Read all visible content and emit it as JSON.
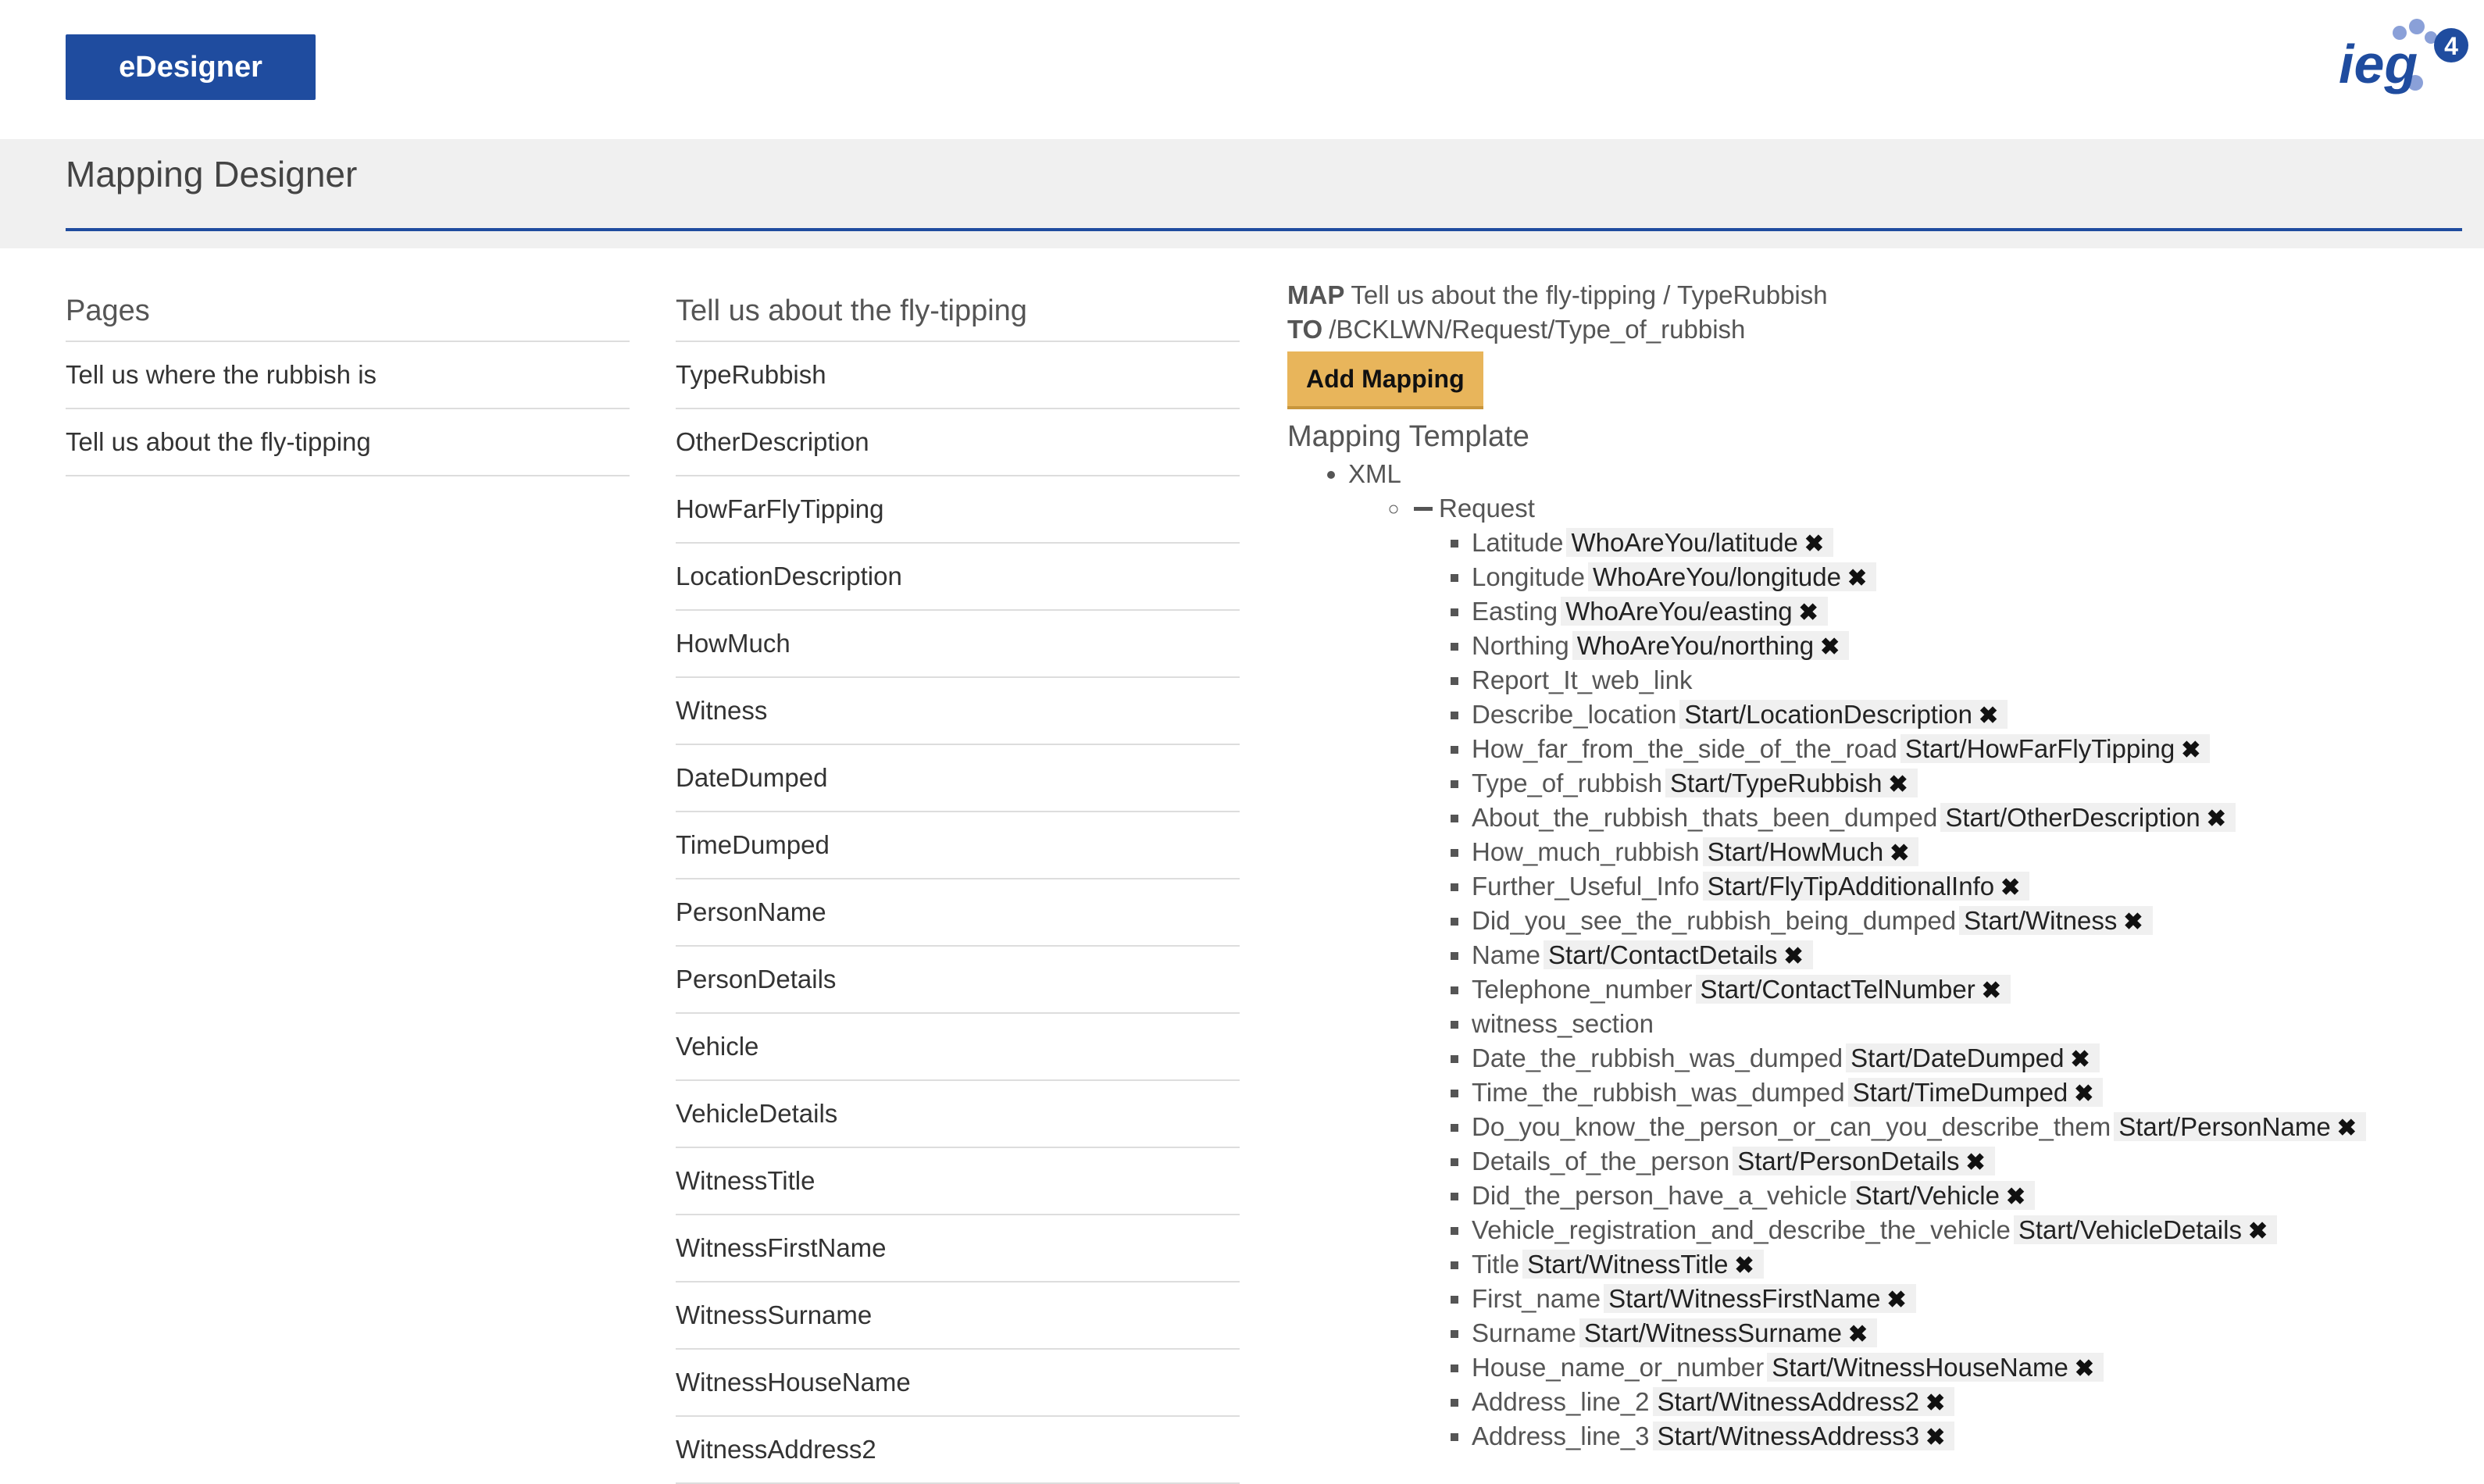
{
  "header": {
    "brand_label": "eDesigner",
    "logo_text": "ieg",
    "logo_badge": "4",
    "logo_colors": {
      "text": "#1f4c9f",
      "dots": "#8aa0d8",
      "badge": "#1f4c9f"
    }
  },
  "page_title": "Mapping Designer",
  "pages": {
    "heading": "Pages",
    "items": [
      {
        "label": "Tell us where the rubbish is"
      },
      {
        "label": "Tell us about the fly-tipping"
      }
    ]
  },
  "fields": {
    "heading": "Tell us about the fly-tipping",
    "items": [
      {
        "label": "TypeRubbish"
      },
      {
        "label": "OtherDescription"
      },
      {
        "label": "HowFarFlyTipping"
      },
      {
        "label": "LocationDescription"
      },
      {
        "label": "HowMuch"
      },
      {
        "label": "Witness"
      },
      {
        "label": "DateDumped"
      },
      {
        "label": "TimeDumped"
      },
      {
        "label": "PersonName"
      },
      {
        "label": "PersonDetails"
      },
      {
        "label": "Vehicle"
      },
      {
        "label": "VehicleDetails"
      },
      {
        "label": "WitnessTitle"
      },
      {
        "label": "WitnessFirstName"
      },
      {
        "label": "WitnessSurname"
      },
      {
        "label": "WitnessHouseName"
      },
      {
        "label": "WitnessAddress2"
      }
    ]
  },
  "mapping": {
    "map_keyword": "MAP",
    "map_value": "Tell us about the fly-tipping / TypeRubbish",
    "to_keyword": "TO",
    "to_value": "/BCKLWN/Request/Type_of_rubbish",
    "add_button_label": "Add Mapping",
    "template_heading": "Mapping Template",
    "root": "XML",
    "request": "Request",
    "remove_icon": "✖",
    "entries": [
      {
        "name": "Latitude",
        "target": "WhoAreYou/latitude"
      },
      {
        "name": "Longitude",
        "target": "WhoAreYou/longitude"
      },
      {
        "name": "Easting",
        "target": "WhoAreYou/easting"
      },
      {
        "name": "Northing",
        "target": "WhoAreYou/northing"
      },
      {
        "name": "Report_It_web_link",
        "target": null
      },
      {
        "name": "Describe_location",
        "target": "Start/LocationDescription"
      },
      {
        "name": "How_far_from_the_side_of_the_road",
        "target": "Start/HowFarFlyTipping"
      },
      {
        "name": "Type_of_rubbish",
        "target": "Start/TypeRubbish"
      },
      {
        "name": "About_the_rubbish_thats_been_dumped",
        "target": "Start/OtherDescription"
      },
      {
        "name": "How_much_rubbish",
        "target": "Start/HowMuch"
      },
      {
        "name": "Further_Useful_Info",
        "target": "Start/FlyTipAdditionalInfo"
      },
      {
        "name": "Did_you_see_the_rubbish_being_dumped",
        "target": "Start/Witness"
      },
      {
        "name": "Name",
        "target": "Start/ContactDetails"
      },
      {
        "name": "Telephone_number",
        "target": "Start/ContactTelNumber"
      },
      {
        "name": "witness_section",
        "target": null
      },
      {
        "name": "Date_the_rubbish_was_dumped",
        "target": "Start/DateDumped"
      },
      {
        "name": "Time_the_rubbish_was_dumped",
        "target": "Start/TimeDumped"
      },
      {
        "name": "Do_you_know_the_person_or_can_you_describe_them",
        "target": "Start/PersonName"
      },
      {
        "name": "Details_of_the_person",
        "target": "Start/PersonDetails"
      },
      {
        "name": "Did_the_person_have_a_vehicle",
        "target": "Start/Vehicle"
      },
      {
        "name": "Vehicle_registration_and_describe_the_vehicle",
        "target": "Start/VehicleDetails"
      },
      {
        "name": "Title",
        "target": "Start/WitnessTitle"
      },
      {
        "name": "First_name",
        "target": "Start/WitnessFirstName"
      },
      {
        "name": "Surname",
        "target": "Start/WitnessSurname"
      },
      {
        "name": "House_name_or_number",
        "target": "Start/WitnessHouseName"
      },
      {
        "name": "Address_line_2",
        "target": "Start/WitnessAddress2"
      },
      {
        "name": "Address_line_3",
        "target": "Start/WitnessAddress3"
      }
    ]
  }
}
